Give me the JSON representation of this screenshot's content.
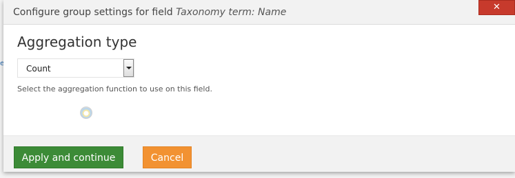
{
  "dialog": {
    "title_prefix": "Configure group settings for field",
    "title_field": "Taxonomy term: Name",
    "close_label": "✕"
  },
  "background": {
    "edge_text": "e"
  },
  "form": {
    "section_title": "Aggregation type",
    "select_value": "Count",
    "help_text": "Select the aggregation function to use on this field."
  },
  "buttons": {
    "apply_label": "Apply and continue",
    "cancel_label": "Cancel"
  },
  "colors": {
    "close": "#c73a2c",
    "apply": "#3c8b37",
    "cancel": "#f29232"
  }
}
